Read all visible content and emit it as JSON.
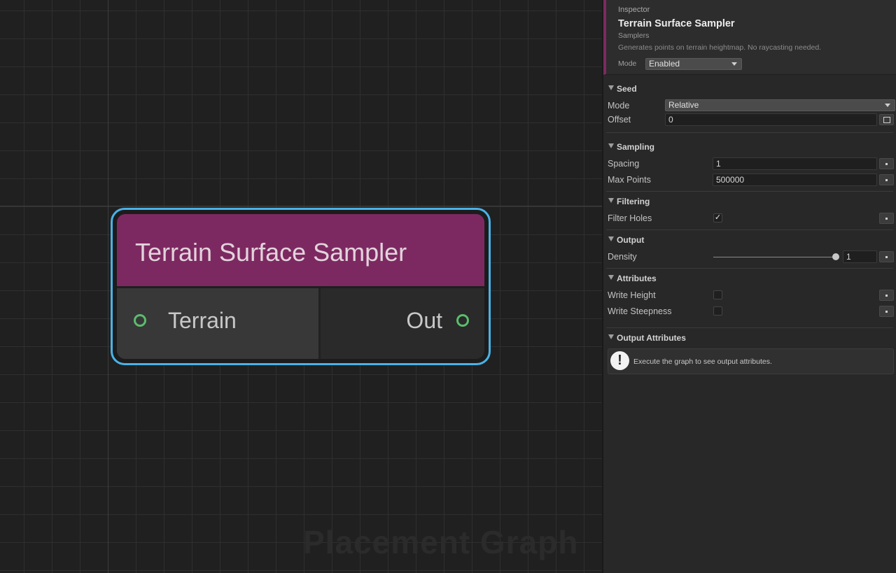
{
  "graph": {
    "watermark": "Placement Graph",
    "node": {
      "title": "Terrain Surface Sampler",
      "title_color": "#7d2961",
      "selection_color": "#4ab2e6",
      "input_port": "Terrain",
      "output_port": "Out",
      "port_color": "#5cbc6e"
    }
  },
  "inspector": {
    "kicker": "Inspector",
    "title": "Terrain Surface Sampler",
    "category": "Samplers",
    "description": "Generates points on terrain heightmap. No raycasting needed.",
    "mode_label": "Mode",
    "mode_value": "Enabled",
    "sections": {
      "seed": {
        "title": "Seed",
        "mode_label": "Mode",
        "mode_value": "Relative",
        "offset_label": "Offset",
        "offset_value": "0"
      },
      "sampling": {
        "title": "Sampling",
        "spacing_label": "Spacing",
        "spacing_value": "1",
        "max_points_label": "Max Points",
        "max_points_value": "500000"
      },
      "filtering": {
        "title": "Filtering",
        "filter_holes_label": "Filter Holes",
        "filter_holes_checked": true,
        "check_mark": "✓"
      },
      "output": {
        "title": "Output",
        "density_label": "Density",
        "density_value": "1",
        "density_fraction": 1.0
      },
      "attributes": {
        "title": "Attributes",
        "write_height_label": "Write Height",
        "write_steepness_label": "Write Steepness"
      },
      "output_attributes": {
        "title": "Output Attributes",
        "info_icon": "!",
        "info_text": "Execute the graph to see output attributes."
      }
    }
  }
}
